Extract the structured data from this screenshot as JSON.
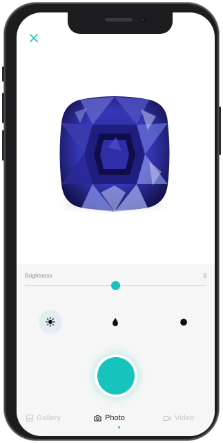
{
  "colors": {
    "accent": "#16c3bd",
    "gem_dark": "#1c1a6e",
    "gem_mid": "#3b3ab0",
    "gem_light": "#7d86e0"
  },
  "header": {
    "close_icon": "close-icon"
  },
  "preview": {
    "subject": "gem-image"
  },
  "controls": {
    "brightness": {
      "label": "Brightness",
      "value": "0",
      "level": 0.5
    },
    "modes": [
      {
        "name": "brightness-mode",
        "icon": "sun-icon",
        "active": true
      },
      {
        "name": "drop-mode",
        "icon": "drop-icon",
        "active": false
      },
      {
        "name": "contrast-mode",
        "icon": "half-circle-icon",
        "active": false
      }
    ],
    "shutter_icon": "shutter-button"
  },
  "nav": {
    "items": [
      {
        "label": "Gallery",
        "icon": "image-icon",
        "active": false
      },
      {
        "label": "Photo",
        "icon": "camera-icon",
        "active": true
      },
      {
        "label": "Video",
        "icon": "video-icon",
        "active": false
      }
    ]
  }
}
